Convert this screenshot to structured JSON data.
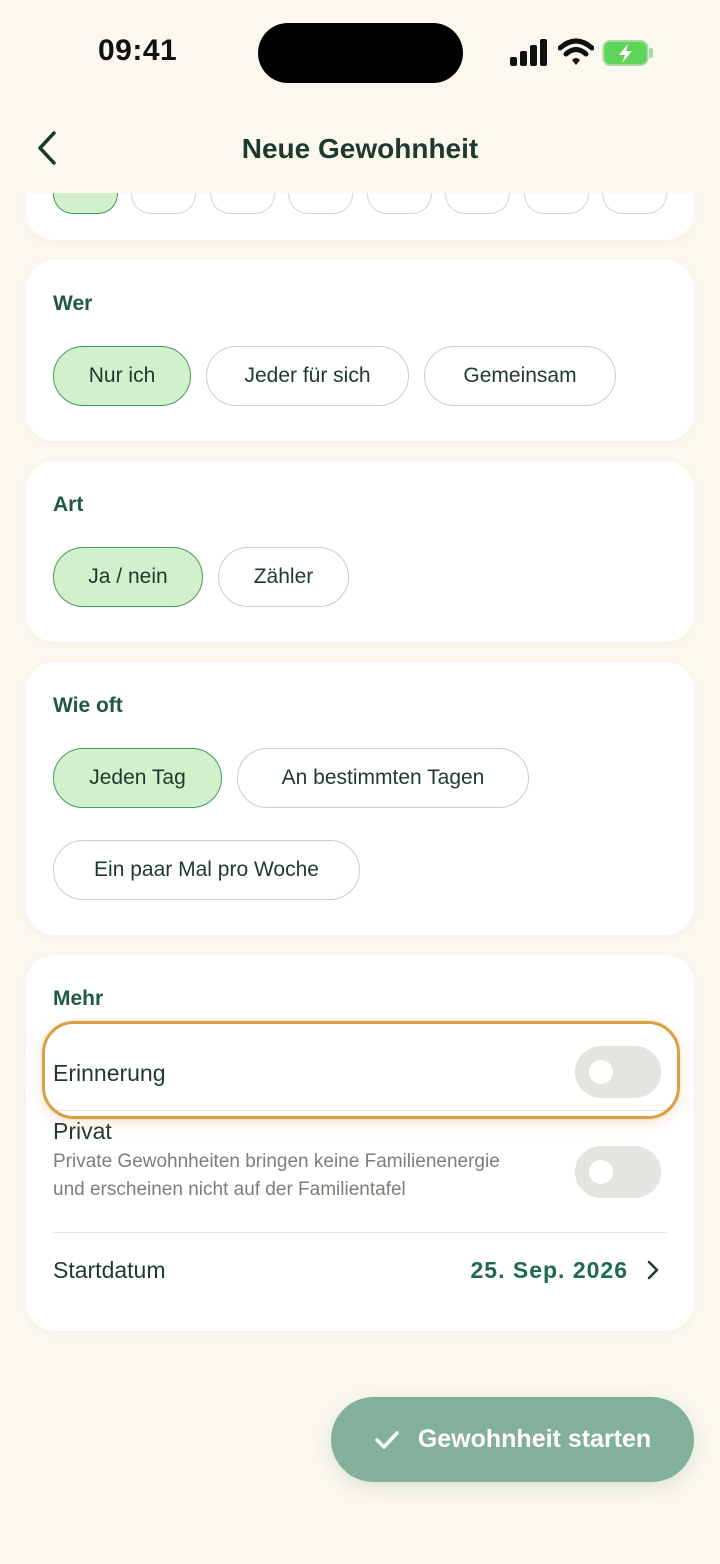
{
  "status_bar": {
    "time": "09:41"
  },
  "header": {
    "title": "Neue Gewohnheit"
  },
  "icon_row": {
    "items": [
      {
        "icon": "selected-green-icon",
        "selected": true,
        "color": "#2FB84F"
      },
      {
        "icon": "note-icon",
        "selected": false,
        "color": "#B6B8E0"
      },
      {
        "icon": "drop-icon",
        "selected": false,
        "color": "#3AA0E0"
      },
      {
        "icon": "music-icon",
        "selected": false,
        "color": "#555555"
      },
      {
        "icon": "book-icon",
        "selected": false,
        "color": "#E6B04A"
      },
      {
        "icon": "hands-icon",
        "selected": false,
        "color": "#C9B49A"
      },
      {
        "icon": "brush-icon",
        "selected": false,
        "color": "#A08054"
      },
      {
        "icon": "pencil-icon",
        "selected": false,
        "color": "#E09A3A"
      }
    ]
  },
  "who": {
    "title": "Wer",
    "options": [
      "Nur ich",
      "Jeder für sich",
      "Gemeinsam"
    ],
    "selected": "Nur ich"
  },
  "type": {
    "title": "Art",
    "options": [
      "Ja / nein",
      "Zähler"
    ],
    "selected": "Ja / nein"
  },
  "frequency": {
    "title": "Wie oft",
    "options": [
      "Jeden Tag",
      "An bestimmten Tagen",
      "Ein paar Mal pro Woche"
    ],
    "selected": "Jeden Tag"
  },
  "more": {
    "title": "Mehr",
    "reminder": {
      "label": "Erinnerung",
      "enabled": false
    },
    "private": {
      "label": "Privat",
      "description": "Private Gewohnheiten bringen keine Familienenergie und erscheinen nicht auf der Familientafel",
      "enabled": false
    },
    "start_date": {
      "label": "Startdatum",
      "value": "25. Sep. 2026"
    }
  },
  "cta": {
    "label": "Gewohnheit starten"
  },
  "colors": {
    "background": "#FBF8EF",
    "accent_dark": "#1E5A40",
    "chip_selected_bg": "#D2F0CB",
    "chip_selected_border": "#3F9D5E",
    "cta_bg": "#83B09A",
    "highlight": "#D9A045"
  }
}
